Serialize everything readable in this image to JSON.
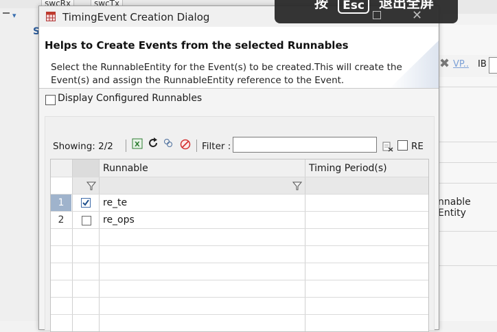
{
  "background": {
    "tabs": [
      "swcRx",
      "swcTx"
    ],
    "right_toolbar_link": "VP..",
    "right_toolbar_label": "IB",
    "right_panel_text": "nnable Entity"
  },
  "dialog": {
    "title": "TimingEvent Creation Dialog",
    "header_title": "Helps to Create Events from the selected Runnables",
    "header_desc": "Select the RunnableEntity for the Event(s) to be created.This will create the Event(s) and assign the RunnableEntity reference to the Event.",
    "display_configured_label": "Display Configured Runnables",
    "showing": "Showing: 2/2",
    "filter_label": "Filter :",
    "filter_value": "",
    "re_label": "RE"
  },
  "grid": {
    "columns": [
      "Runnable",
      "Timing Period(s)"
    ],
    "rows": [
      {
        "num": "1",
        "checked": true,
        "runnable": "re_te",
        "period": ""
      },
      {
        "num": "2",
        "checked": false,
        "runnable": "re_ops",
        "period": ""
      }
    ]
  },
  "overlay": {
    "text_before": "按",
    "key": "Esc",
    "text_after": "退出全屏"
  },
  "colors": {
    "selected_row_header": "#9fb3cc",
    "dialog_header_bg": "#ffffff",
    "overlay_bg": "#2a2a2a"
  }
}
